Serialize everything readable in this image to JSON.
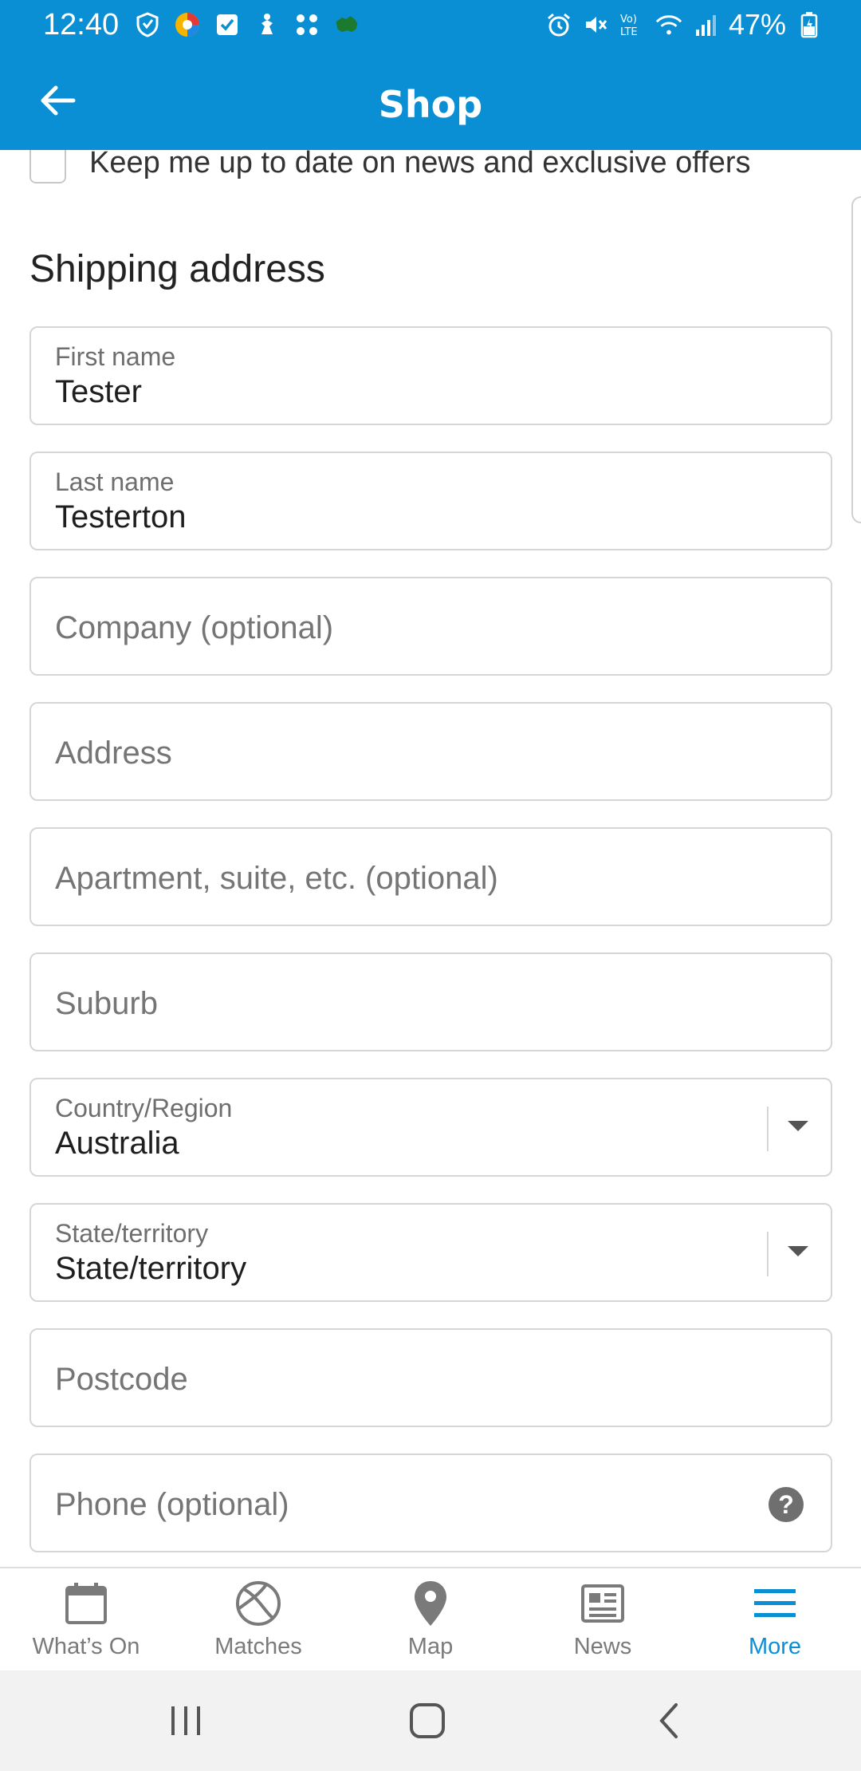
{
  "status_bar": {
    "time": "12:40",
    "battery": "47%",
    "icons": [
      "shield-icon",
      "browser-icon",
      "check-icon",
      "figure-icon",
      "dots-icon",
      "map-icon",
      "alarm-icon",
      "mute-icon",
      "volte-icon",
      "wifi-icon",
      "signal-icon",
      "battery-icon"
    ]
  },
  "app_bar": {
    "title": "Shop",
    "back_icon": "arrow-left-icon"
  },
  "form": {
    "newsletter_label": "Keep me up to date on news and exclusive offers",
    "newsletter_checked": false,
    "section_title": "Shipping address",
    "first_name": {
      "label": "First name",
      "value": "Tester"
    },
    "last_name": {
      "label": "Last name",
      "value": "Testerton"
    },
    "company": {
      "placeholder": "Company (optional)"
    },
    "address": {
      "placeholder": "Address"
    },
    "apartment": {
      "placeholder": "Apartment, suite, etc. (optional)"
    },
    "suburb": {
      "placeholder": "Suburb"
    },
    "country": {
      "label": "Country/Region",
      "value": "Australia"
    },
    "state": {
      "label": "State/territory",
      "value": "State/territory"
    },
    "postcode": {
      "placeholder": "Postcode"
    },
    "phone": {
      "placeholder": "Phone (optional)",
      "help": "?"
    }
  },
  "bottom_nav": {
    "items": [
      {
        "label": "What’s On",
        "icon": "calendar-icon"
      },
      {
        "label": "Matches",
        "icon": "ball-icon"
      },
      {
        "label": "Map",
        "icon": "pin-icon"
      },
      {
        "label": "News",
        "icon": "newspaper-icon"
      },
      {
        "label": "More",
        "icon": "menu-icon"
      }
    ],
    "active": "More"
  },
  "colors": {
    "brand": "#0b8fd4",
    "text": "#202020",
    "placeholder": "#757575",
    "border": "#d6d6d6"
  }
}
